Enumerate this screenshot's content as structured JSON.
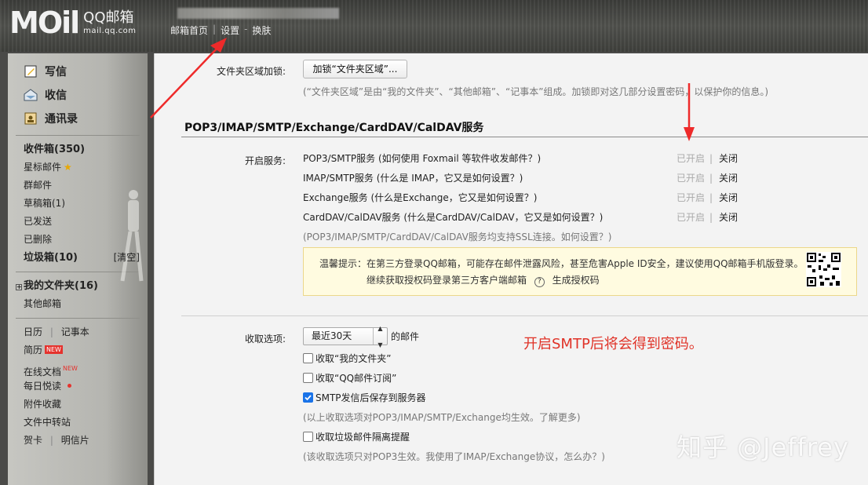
{
  "header": {
    "logo_mark": "MOil",
    "logo_name": "QQ邮箱",
    "logo_domain": "mail.qq.com",
    "nav": [
      {
        "label": "邮箱首页"
      },
      {
        "label": "设置"
      },
      {
        "label": "换肤"
      }
    ]
  },
  "sidebar": {
    "main": [
      {
        "label": "写信",
        "icon": "pencil-icon"
      },
      {
        "label": "收信",
        "icon": "inbox-tray-icon"
      },
      {
        "label": "通讯录",
        "icon": "address-book-icon"
      }
    ],
    "folders": [
      {
        "label": "收件箱(350)"
      },
      {
        "label": "星标邮件"
      },
      {
        "label": "群邮件"
      },
      {
        "label": "草稿箱(1)"
      },
      {
        "label": "已发送"
      },
      {
        "label": "已删除"
      },
      {
        "label": "垃圾箱(10)",
        "action": "[清空]"
      }
    ],
    "my_folders": {
      "label": "我的文件夹(16)",
      "toggle": "+"
    },
    "other_mailbox": "其他邮箱",
    "tools": {
      "calendar": "日历",
      "notes": "记事本",
      "resume": "简历",
      "new_badge": "NEW",
      "online_docs": "在线文档",
      "daily": "每日悦读",
      "attachments": "附件收藏",
      "transfer": "文件中转站",
      "cards": "贺卡",
      "postcard": "明信片"
    }
  },
  "content": {
    "folder_lock": {
      "label": "文件夹区域加锁:",
      "button": "加锁“文件夹区域”...",
      "hint": "(“文件夹区域”是由“我的文件夹”、“其他邮箱”、“记事本”组成。加锁即对这几部分设置密码，以保护你的信息。)"
    },
    "section_title": "POP3/IMAP/SMTP/Exchange/CardDAV/CalDAV服务",
    "services_label": "开启服务:",
    "services": [
      {
        "name": "POP3/SMTP服务 (如何使用 Foxmail 等软件收发邮件？)",
        "status": "已开启",
        "action": "关闭"
      },
      {
        "name": "IMAP/SMTP服务 (什么是 IMAP，它又是如何设置？)",
        "status": "已开启",
        "action": "关闭"
      },
      {
        "name": "Exchange服务 (什么是Exchange，它又是如何设置？)",
        "status": "已开启",
        "action": "关闭"
      },
      {
        "name": "CardDAV/CalDAV服务 (什么是CardDAV/CalDAV，它又是如何设置？)",
        "status": "已开启",
        "action": "关闭"
      }
    ],
    "ssl_hint": "(POP3/IMAP/SMTP/CardDAV/CalDAV服务均支持SSL连接。如何设置？)",
    "warning": {
      "line1": "温馨提示：在第三方登录QQ邮箱，可能存在邮件泄露风险，甚至危害Apple ID安全，建议使用QQ邮箱手机版登录。",
      "line2": "继续获取授权码登录第三方客户端邮箱",
      "help_mark": "?",
      "link": "生成授权码"
    },
    "receive": {
      "label": "收取选项:",
      "select_value": "最近30天",
      "select_suffix": "的邮件",
      "options": [
        {
          "label": "收取“我的文件夹”",
          "checked": false
        },
        {
          "label": "收取“QQ邮件订阅”",
          "checked": false
        },
        {
          "label": "SMTP发信后保存到服务器",
          "checked": true
        }
      ],
      "hint1": "(以上收取选项对POP3/IMAP/SMTP/Exchange均生效。了解更多)",
      "spam_option": {
        "label": "收取垃圾邮件隔离提醒",
        "checked": false
      },
      "hint2": "(该收取选项只对POP3生效。我使用了IMAP/Exchange协议，怎么办？)"
    },
    "annotation": "开启SMTP后将会得到密码。"
  },
  "watermark": "知乎 @Jeffrey",
  "colors": {
    "accent_red": "#e03227",
    "checkbox_blue": "#1a73e8"
  }
}
